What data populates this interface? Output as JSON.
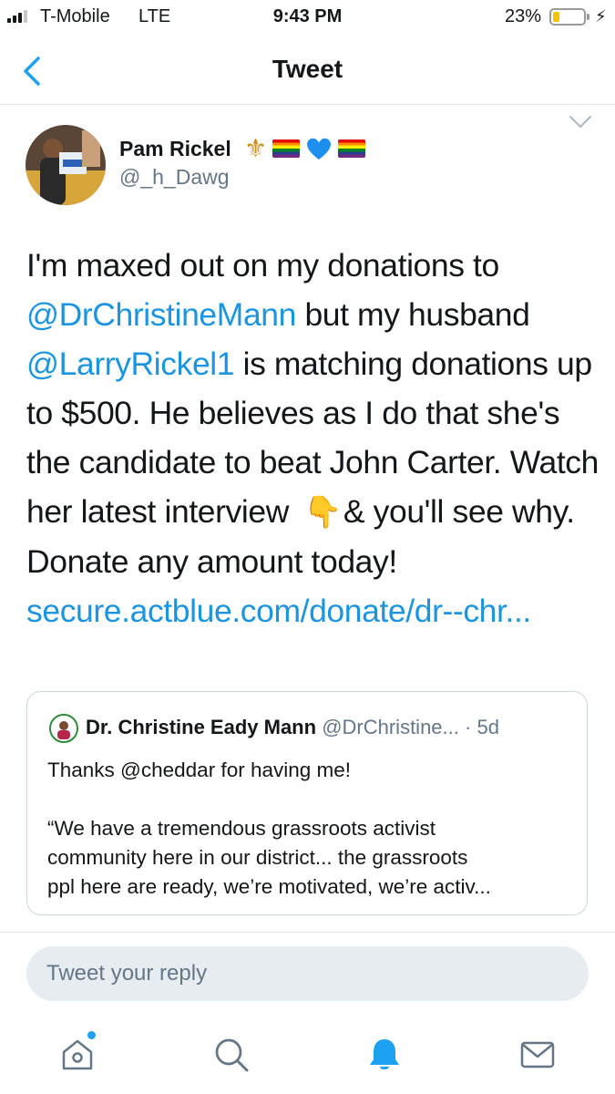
{
  "status_bar": {
    "carrier": "T-Mobile",
    "network": "LTE",
    "time": "9:43 PM",
    "battery_percent": "23%",
    "battery_level": 0.23,
    "charging_icon": "bolt-icon"
  },
  "nav": {
    "title": "Tweet",
    "back_icon": "chevron-left-icon"
  },
  "tweet": {
    "author": {
      "display_name": "Pam Rickel",
      "handle": "@_h_Dawg",
      "name_emoji": [
        "fleur-de-lis",
        "rainbow-flag",
        "blue-heart",
        "rainbow-flag"
      ]
    },
    "body": {
      "text1": "I'm maxed out on my donations to",
      "mention1": "@DrChristineMann",
      "text2": " but my husband",
      "mention2": "@LarryRickel1",
      "text3": " is matching donations up to $500. He believes as I do that she's the candidate to beat John Carter. Watch her latest interview",
      "emoji": "👇",
      "text4": "& you'll see why. Donate any amount today!",
      "link": "secure.actblue.com/donate/dr--chr..."
    },
    "quoted": {
      "name": "Dr. Christine Eady Mann",
      "handle": "@DrChristine...",
      "time": "· 5d",
      "line1": "Thanks @cheddar for having me!",
      "line2": "“We have a tremendous grassroots activist",
      "line3": "community here in our district... the grassroots",
      "line4": "ppl here are ready, we’re motivated, we’re activ..."
    }
  },
  "reply": {
    "placeholder": "Tweet your reply"
  },
  "tab_bar": {
    "items": [
      "home-icon",
      "search-icon",
      "notifications-icon",
      "messages-icon"
    ],
    "active": "notifications-icon"
  },
  "colors": {
    "link": "#1b95e0",
    "secondary_text": "#657786",
    "accent": "#1da1f2",
    "border": "#e1e8ed"
  }
}
